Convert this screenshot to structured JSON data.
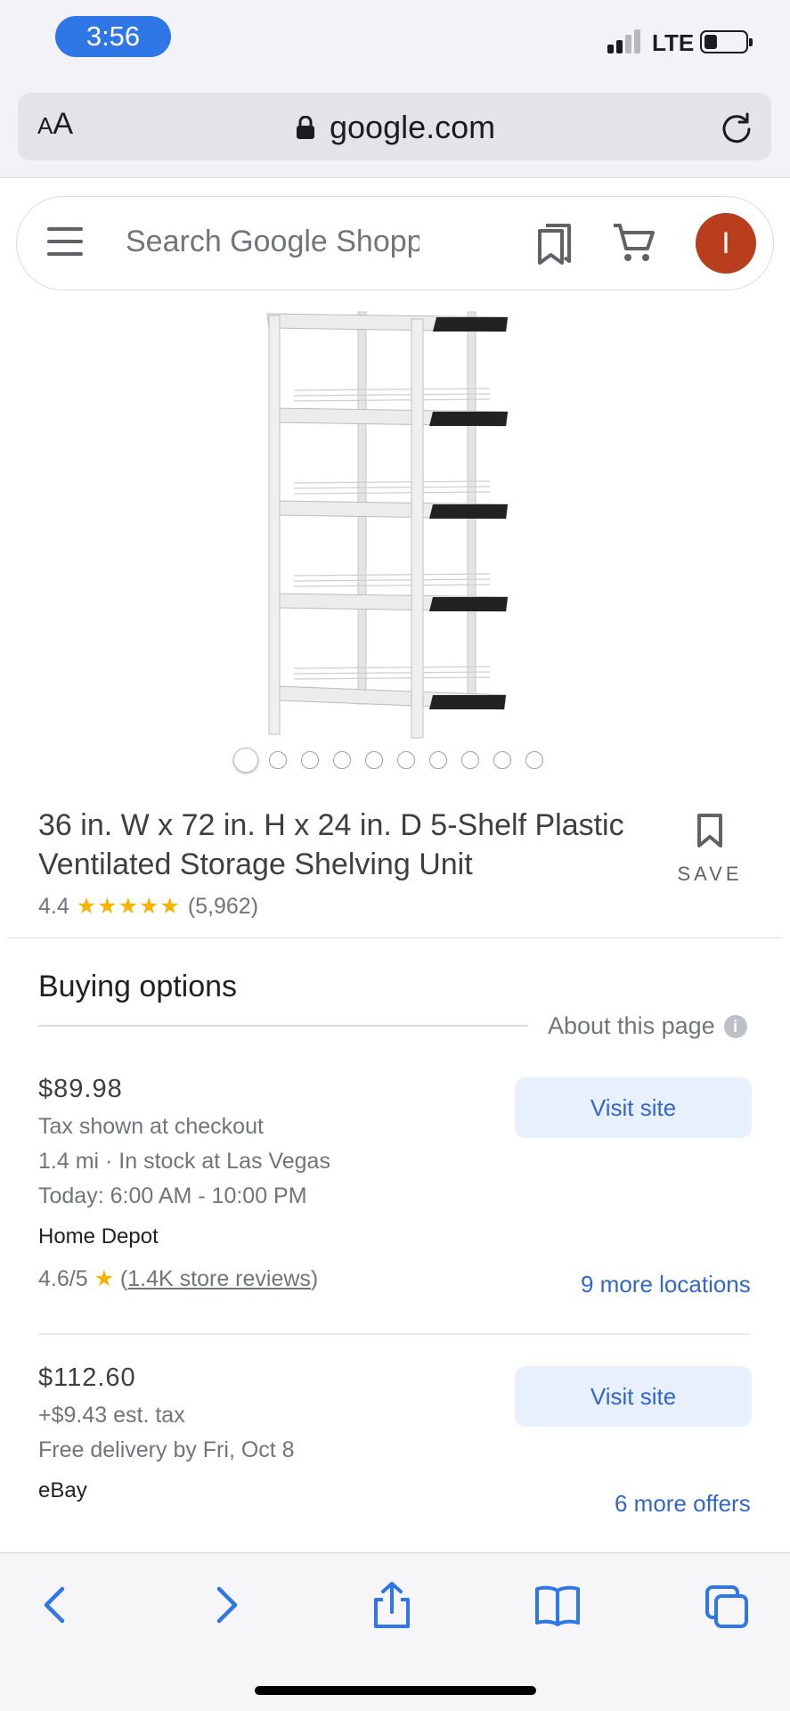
{
  "status_bar": {
    "time": "3:56",
    "network": "LTE",
    "battery_level": 0.25
  },
  "browser": {
    "text_size_label_small": "A",
    "text_size_label_large": "A",
    "domain": "google.com"
  },
  "search": {
    "placeholder": "Search Google Shopping",
    "avatar_initial": "I"
  },
  "carousel": {
    "total": 10,
    "active_index": 0
  },
  "product": {
    "title": "36 in. W x 72 in. H x 24 in. D 5-Shelf Plastic Ventilated Storage Shelving Unit",
    "save_label": "SAVE",
    "rating": "4.4",
    "stars": "★★★★★",
    "review_count": "(5,962)"
  },
  "buying_options": {
    "title": "Buying options",
    "about_label": "About this page",
    "offers": [
      {
        "price": "$89.98",
        "line1": "Tax shown at checkout",
        "line2": "1.4 mi · In stock at Las Vegas",
        "line3": "Today: 6:00 AM - 10:00 PM",
        "merchant": "Home Depot",
        "store_rating": "4.6/5",
        "store_reviews": "1.4K store reviews",
        "visit_label": "Visit site",
        "more_label": "9 more locations"
      },
      {
        "price": "$112.60",
        "line1": "+$9.43 est. tax",
        "line2": "Free delivery by Fri, Oct 8",
        "merchant": "eBay",
        "visit_label": "Visit site",
        "more_label": "6 more offers"
      }
    ]
  },
  "colors": {
    "accent": "#1a73e8",
    "button_bg": "#e8f0fe",
    "star": "#f5b400",
    "avatar": "#b83e1e",
    "ios_blue": "#2f76e6"
  },
  "toolbar": {
    "icons": [
      "back-icon",
      "forward-icon",
      "share-icon",
      "bookmarks-book-icon",
      "tabs-icon"
    ]
  }
}
